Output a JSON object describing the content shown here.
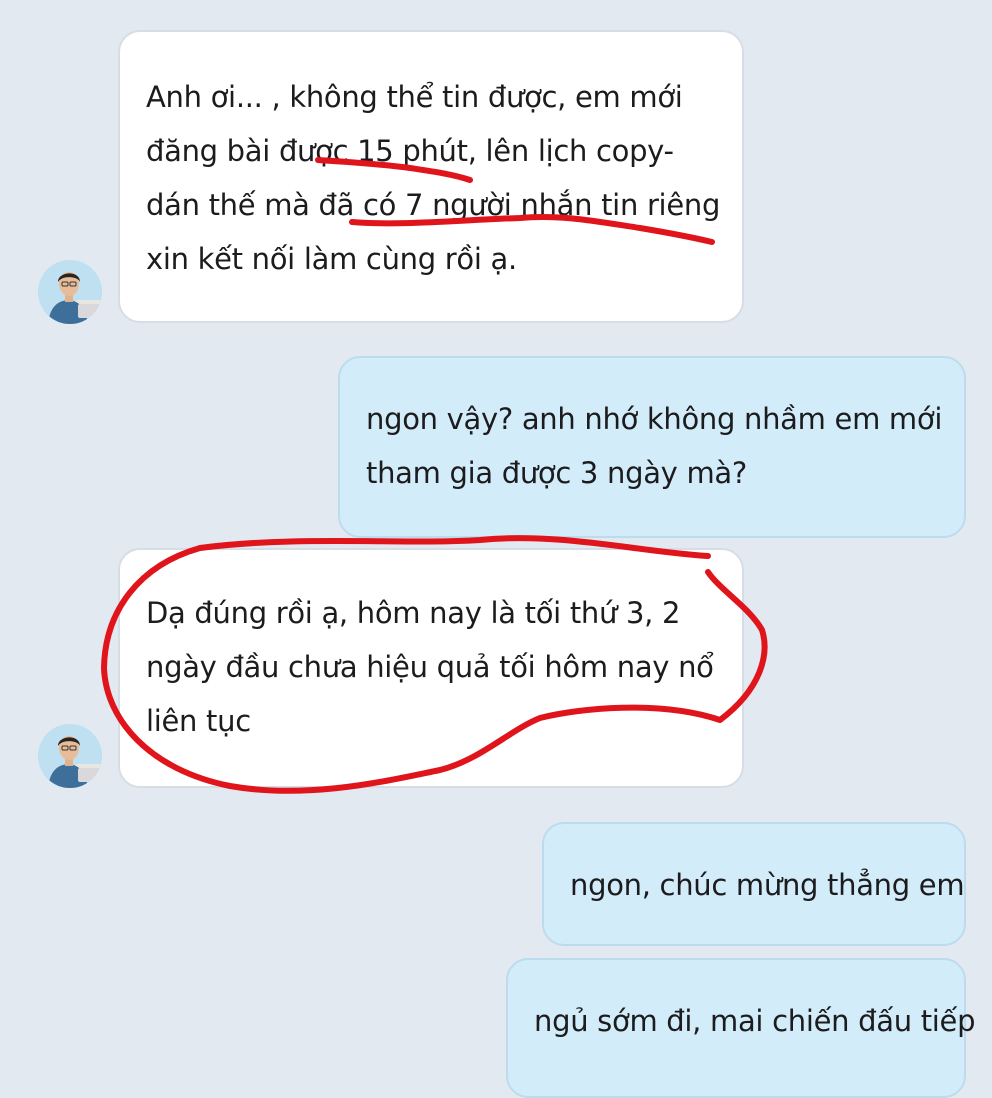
{
  "messages": [
    {
      "direction": "incoming",
      "lines": [
        "Anh ơi...       , không thể tin được, em mới",
        "đăng bài được 15 phút, lên lịch copy-",
        "dán thế mà đã có 7 người nhắn tin riêng",
        "xin kết nối làm cùng rồi ạ."
      ]
    },
    {
      "direction": "outgoing",
      "lines": [
        "ngon vậy? anh nhớ không nhầm em mới",
        "tham gia được 3 ngày mà?"
      ]
    },
    {
      "direction": "incoming",
      "lines": [
        "Dạ đúng rồi ạ, hôm nay là tối thứ 3, 2",
        "ngày đầu chưa hiệu quả tối hôm nay nổ",
        "liên tục"
      ]
    },
    {
      "direction": "outgoing",
      "lines": [
        "ngon, chúc mừng thẳng em"
      ]
    },
    {
      "direction": "outgoing",
      "lines": [
        "ngủ sớm đi, mai chiến đấu tiếp"
      ]
    }
  ],
  "colors": {
    "background": "#e3e9f1",
    "incoming_bubble": "#ffffff",
    "outgoing_bubble": "#d3ecfa",
    "annotation": "#e0141b"
  },
  "icons": {
    "avatar": "user-avatar-photo"
  }
}
